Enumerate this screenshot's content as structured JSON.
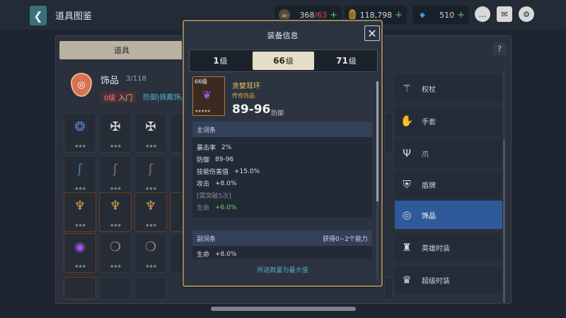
{
  "header": {
    "title": "道具图鉴",
    "back_icon": "chevron-left-icon",
    "resources": [
      {
        "icon": "coffee-icon",
        "current": "368",
        "max": "/63",
        "plus": "+"
      },
      {
        "icon": "gold-coin-icon",
        "value": "118,798",
        "plus": "+"
      },
      {
        "icon": "diamond-icon",
        "value": "510",
        "plus": "+"
      }
    ],
    "buttons": [
      "chat-icon",
      "mail-icon",
      "gear-icon"
    ]
  },
  "panel": {
    "tab_label": "道具",
    "help_label": "?",
    "category": {
      "name": "饰品",
      "count": "3/118",
      "level_num": "0级",
      "level_text": "入门",
      "desc": "防御|佩戴饰品后"
    }
  },
  "slots_stars": "★★★",
  "categories": [
    {
      "label": "权杖",
      "icon": "wand-icon",
      "active": false
    },
    {
      "label": "手套",
      "icon": "glove-icon",
      "active": false
    },
    {
      "label": "爪",
      "icon": "claw-icon",
      "active": false
    },
    {
      "label": "盾牌",
      "icon": "shield-icon",
      "active": false
    },
    {
      "label": "饰品",
      "icon": "ring-icon",
      "active": true
    },
    {
      "label": "英雄时装",
      "icon": "costume-icon",
      "active": false
    },
    {
      "label": "超级时装",
      "icon": "suit-icon",
      "active": false
    }
  ],
  "modal": {
    "title": "装备信息",
    "close": "✕",
    "level_tabs": [
      {
        "num": "1",
        "unit": "级"
      },
      {
        "num": "66",
        "unit": "级"
      },
      {
        "num": "71",
        "unit": "级"
      }
    ],
    "equip": {
      "level": "66级",
      "stars": "★★★★★",
      "name": "贪婪耳环",
      "rarity": "传奇饰品",
      "range": "89-96",
      "range_label": "防御"
    },
    "main_section": {
      "title": "主词条",
      "lines": [
        {
          "k": "暴击率",
          "v": "2%"
        },
        {
          "k": "防御",
          "v": "89-96"
        },
        {
          "k": "技能伤害值",
          "v": "+15.0%"
        },
        {
          "k": "攻击",
          "v": "+8.0%"
        },
        {
          "k": "[需突破5次]",
          "v": ""
        },
        {
          "k": "生命",
          "v": "+6.0%"
        }
      ]
    },
    "sub_section": {
      "title": "副词条",
      "right": "获得0~2个能力",
      "lines": [
        {
          "k": "生命",
          "v": "+8.0%"
        }
      ]
    },
    "footer": "所选数量为最大值"
  }
}
